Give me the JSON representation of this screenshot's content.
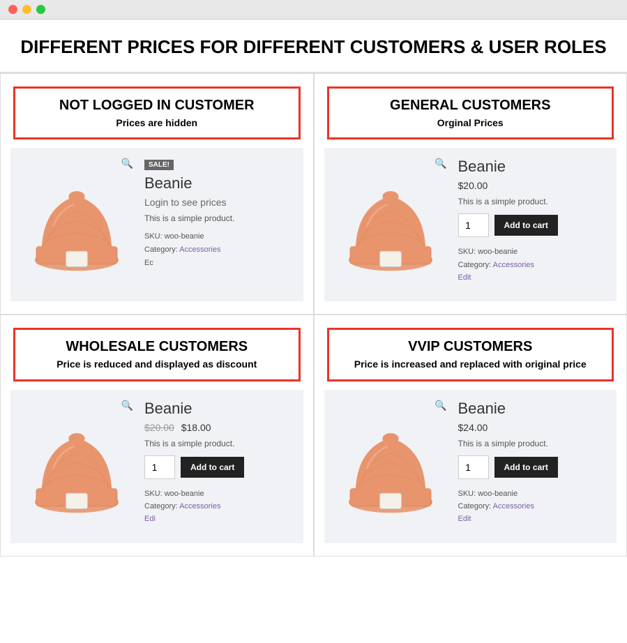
{
  "window": {
    "dots": [
      "red",
      "yellow",
      "green"
    ]
  },
  "page": {
    "title": "DIFFERENT PRICES FOR DIFFERENT CUSTOMERS & USER ROLES"
  },
  "cells": [
    {
      "id": "not-logged-in",
      "label_title": "NOT LOGGED IN CUSTOMER",
      "label_subtitle": "Prices are hidden",
      "show_sale_badge": true,
      "sale_badge_text": "SALE!",
      "product_name": "Beanie",
      "price_display": "login",
      "login_text": "Login to see prices",
      "description": "This is a simple product.",
      "show_add_to_cart": false,
      "sku": "SKU: woo-beanie",
      "category": "Category: Accessories",
      "extra": "Ec",
      "edit_label": null
    },
    {
      "id": "general-customers",
      "label_title": "GENERAL CUSTOMERS",
      "label_subtitle": "Orginal Prices",
      "show_sale_badge": false,
      "sale_badge_text": "",
      "product_name": "Beanie",
      "price_display": "normal",
      "price": "$20.00",
      "description": "This is a simple product.",
      "show_add_to_cart": true,
      "qty": "1",
      "add_to_cart_label": "Add to cart",
      "sku": "SKU: woo-beanie",
      "category": "Category: Accessories",
      "edit_label": "Edit"
    },
    {
      "id": "wholesale-customers",
      "label_title": "WHOLESALE CUSTOMERS",
      "label_subtitle": "Price is reduced and displayed as discount",
      "show_sale_badge": false,
      "sale_badge_text": "",
      "product_name": "Beanie",
      "price_display": "discount",
      "price_original": "$20.00",
      "price_sale": "$18.00",
      "description": "This is a simple product.",
      "show_add_to_cart": true,
      "qty": "1",
      "add_to_cart_label": "Add to cart",
      "sku": "SKU: woo-beanie",
      "category": "Category: Accessories",
      "edit_label": "Edi"
    },
    {
      "id": "vvip-customers",
      "label_title": "VVIP CUSTOMERS",
      "label_subtitle": "Price is increased and replaced with original price",
      "show_sale_badge": false,
      "sale_badge_text": "",
      "product_name": "Beanie",
      "price_display": "increased",
      "price": "$24.00",
      "description": "This is a simple product.",
      "show_add_to_cart": true,
      "qty": "1",
      "add_to_cart_label": "Add to cart",
      "sku": "SKU: woo-beanie",
      "category": "Category: Accessories",
      "edit_label": "Edit"
    }
  ]
}
